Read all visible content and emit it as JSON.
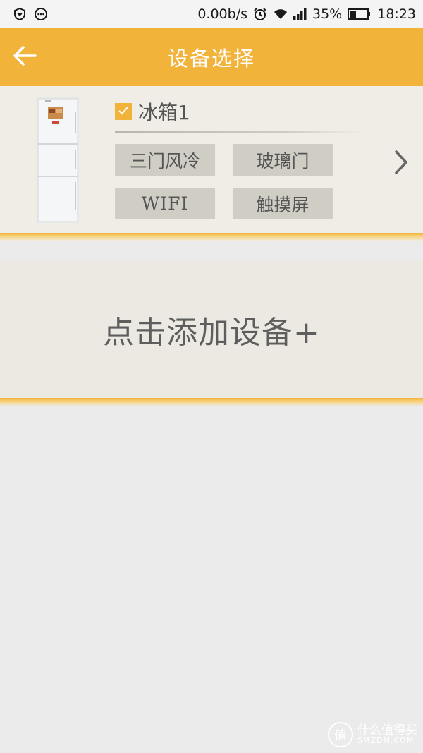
{
  "status_bar": {
    "speed": "0.00b/s",
    "battery": "35%",
    "time": "18:23"
  },
  "header": {
    "title": "设备选择"
  },
  "device": {
    "name": "冰箱1",
    "checked": true,
    "tags": [
      "三门风冷",
      "玻璃门",
      "WIFI",
      "触摸屏"
    ]
  },
  "add_device": {
    "label": "点击添加设备+"
  },
  "watermark": {
    "cn": "什么值得买",
    "en": "SMZDM.COM",
    "badge": "值"
  },
  "colors": {
    "accent": "#f2b33b",
    "card_bg": "#efede6",
    "tag_bg": "#cfcdc4",
    "page_bg": "#ebebeb"
  }
}
